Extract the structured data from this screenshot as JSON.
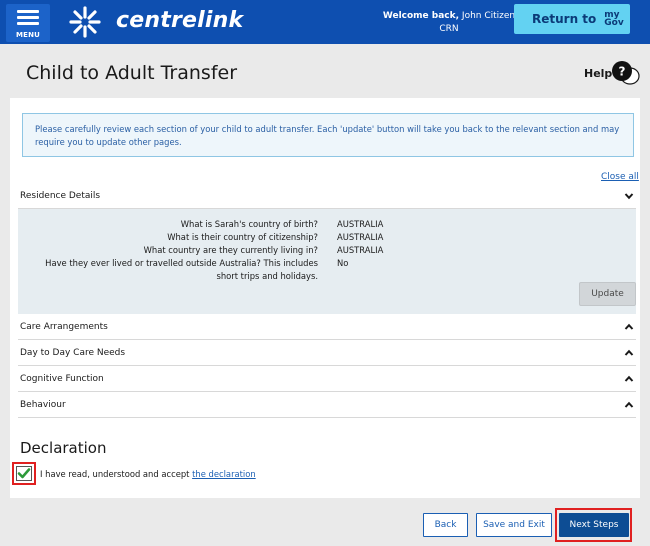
{
  "header": {
    "menu_label": "MENU",
    "logo_text": "centrelink",
    "welcome_prefix": "Welcome back,",
    "user_name": "John Citizen",
    "crn_label": "CRN",
    "return_label": "Return to",
    "mygov_line1": "my",
    "mygov_line2": "Gov",
    "brand_color": "#0e4fb0",
    "return_color": "#63d2f2"
  },
  "page": {
    "title": "Child to Adult Transfer",
    "help_label": "Help",
    "help_icon": "question-bubble-icon"
  },
  "notice": {
    "text": "Please carefully review each section of your child to adult transfer. Each 'update' button will take you back to the relevant section and may require you to update other pages."
  },
  "controls": {
    "close_all": "Close all",
    "update_label": "Update"
  },
  "sections": [
    {
      "label": "Residence Details",
      "state": "expanded"
    },
    {
      "label": "Care Arrangements",
      "state": "collapsed"
    },
    {
      "label": "Day to Day Care Needs",
      "state": "collapsed"
    },
    {
      "label": "Cognitive Function",
      "state": "collapsed"
    },
    {
      "label": "Behaviour",
      "state": "collapsed"
    }
  ],
  "residence": {
    "rows": [
      {
        "q": "What is Sarah's country of birth?",
        "a": "AUSTRALIA"
      },
      {
        "q": "What is their country of citizenship?",
        "a": "AUSTRALIA"
      },
      {
        "q": "What country are they currently living in?",
        "a": "AUSTRALIA"
      },
      {
        "q_line1": "Have they ever lived or travelled outside Australia? This includes",
        "q_line2": "short trips and holidays.",
        "a": "No"
      }
    ]
  },
  "declaration": {
    "title": "Declaration",
    "checked": true,
    "text": "I have read, understood and accept",
    "link": "the declaration"
  },
  "footer": {
    "back": "Back",
    "save_exit": "Save and Exit",
    "next": "Next Steps",
    "highlight_color": "#e02020"
  }
}
